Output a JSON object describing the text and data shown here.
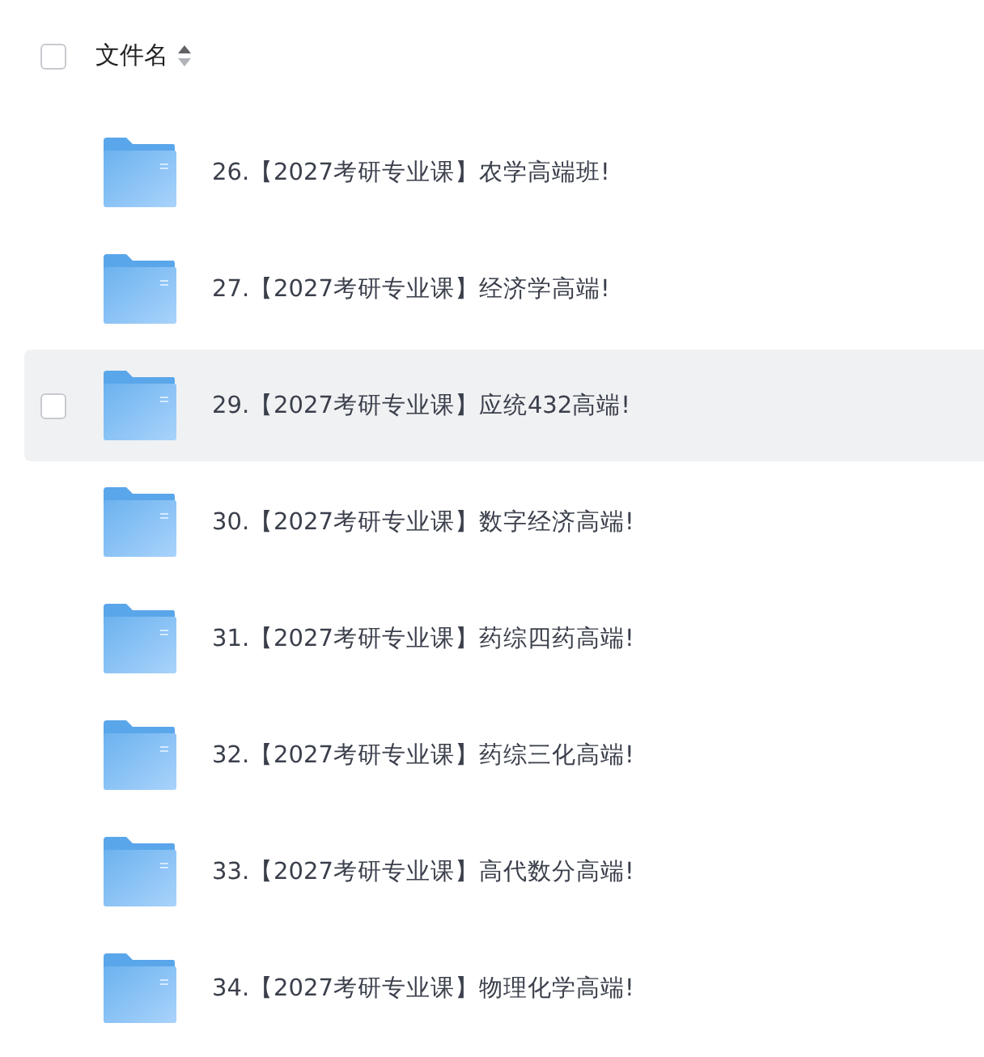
{
  "header": {
    "checked": false,
    "label": "文件名"
  },
  "rows": [
    {
      "name": "26.【2027考研专业课】农学高端班!",
      "highlighted": false,
      "checked": false
    },
    {
      "name": "27.【2027考研专业课】经济学高端!",
      "highlighted": false,
      "checked": false
    },
    {
      "name": "29.【2027考研专业课】应统432高端!",
      "highlighted": true,
      "checked": false
    },
    {
      "name": "30.【2027考研专业课】数字经济高端!",
      "highlighted": false,
      "checked": false
    },
    {
      "name": "31.【2027考研专业课】药综四药高端!",
      "highlighted": false,
      "checked": false
    },
    {
      "name": "32.【2027考研专业课】药综三化高端!",
      "highlighted": false,
      "checked": false
    },
    {
      "name": "33.【2027考研专业课】高代数分高端!",
      "highlighted": false,
      "checked": false
    },
    {
      "name": "34.【2027考研专业课】物理化学高端!",
      "highlighted": false,
      "checked": false
    }
  ]
}
